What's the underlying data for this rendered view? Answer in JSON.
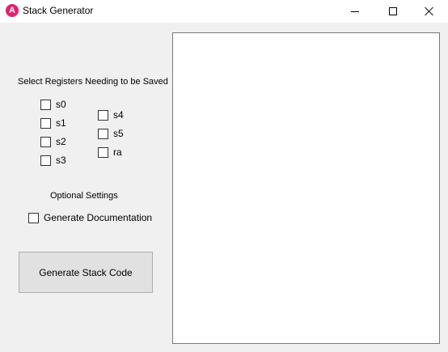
{
  "window": {
    "title": "Stack Generator",
    "app_icon_letter": "A",
    "icon_color": "#e8206b"
  },
  "registers": {
    "heading": "Select Registers Needing to be Saved",
    "left_column": [
      {
        "label": "s0",
        "checked": false
      },
      {
        "label": "s1",
        "checked": false
      },
      {
        "label": "s2",
        "checked": false
      },
      {
        "label": "s3",
        "checked": false
      }
    ],
    "right_column": [
      {
        "label": "s4",
        "checked": false
      },
      {
        "label": "s5",
        "checked": false
      },
      {
        "label": "ra",
        "checked": false
      }
    ]
  },
  "optional": {
    "heading": "Optional Settings",
    "generate_documentation": {
      "label": "Generate Documentation",
      "checked": false
    }
  },
  "actions": {
    "generate_label": "Generate Stack Code"
  },
  "output": {
    "text": ""
  }
}
